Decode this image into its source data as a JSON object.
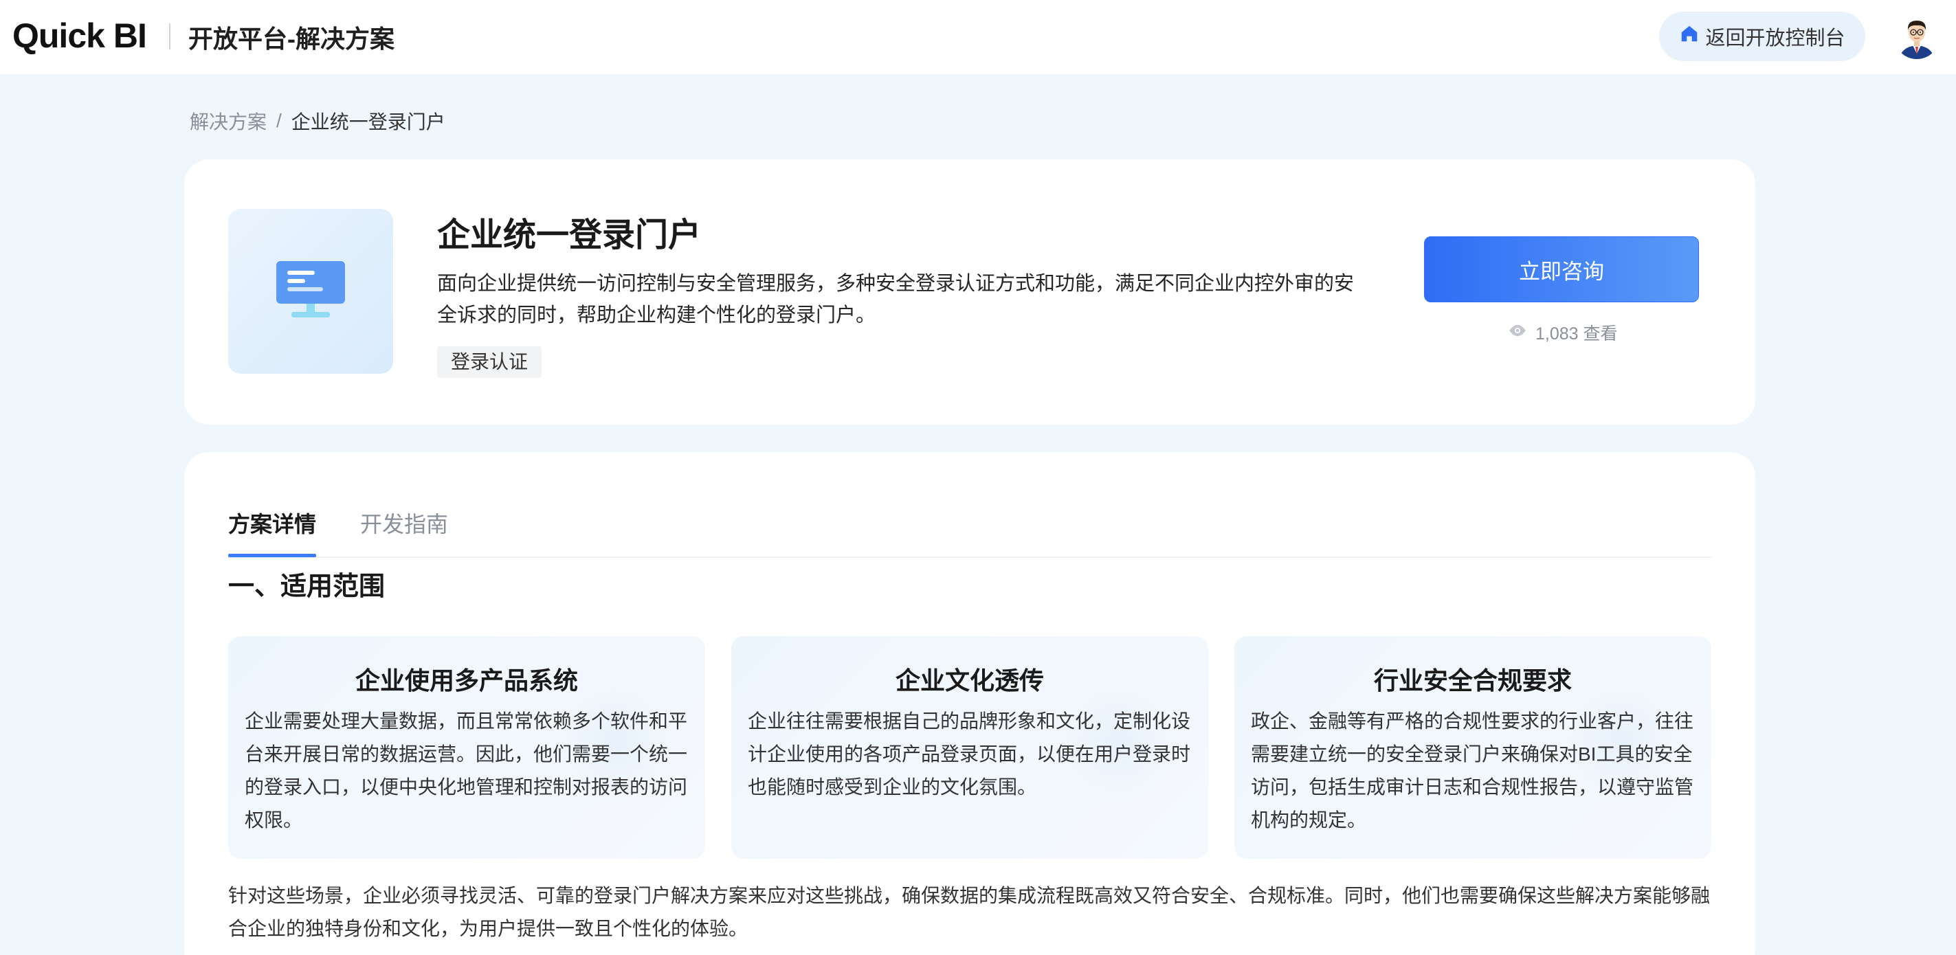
{
  "header": {
    "logo": "Quick BI",
    "platform_title": "开放平台-解决方案",
    "back_button_label": "返回开放控制台",
    "back_icon": "home-icon",
    "avatar": "user-avatar"
  },
  "breadcrumb": {
    "root": "解决方案",
    "separator": "/",
    "current": "企业统一登录门户"
  },
  "solution": {
    "icon": "monitor-icon",
    "title": "企业统一登录门户",
    "description": "面向企业提供统一访问控制与安全管理服务，多种安全登录认证方式和功能，满足不同企业内控外审的安全诉求的同时，帮助企业构建个性化的登录门户。",
    "tag": "登录认证",
    "consult_label": "立即咨询",
    "views_icon": "eye-icon",
    "views": "1,083 查看"
  },
  "tabs": [
    {
      "label": "方案详情",
      "active": true
    },
    {
      "label": "开发指南",
      "active": false
    }
  ],
  "content": {
    "section_title": "一、适用范围",
    "scenes": [
      {
        "title": "企业使用多产品系统",
        "description": "企业需要处理大量数据，而且常常依赖多个软件和平台来开展日常的数据运营。因此，他们需要一个统一的登录入口，以便中央化地管理和控制对报表的访问权限。"
      },
      {
        "title": "企业文化透传",
        "description": "企业往往需要根据自己的品牌形象和文化，定制化设计企业使用的各项产品登录页面，以便在用户登录时也能随时感受到企业的文化氛围。"
      },
      {
        "title": "行业安全合规要求",
        "description": "政企、金融等有严格的合规性要求的行业客户，往往需要建立统一的安全登录门户来确保对BI工具的安全访问，包括生成审计日志和合规性报告，以遵守监管机构的规定。"
      }
    ],
    "summary": "针对这些场景，企业必须寻找灵活、可靠的登录门户解决方案来应对这些挑战，确保数据的集成流程既高效又符合安全、合规标准。同时，他们也需要确保这些解决方案能够融合企业的独特身份和文化，为用户提供一致且个性化的体验。"
  },
  "colors": {
    "accent": "#2f6df5",
    "page_bg": "#f0f7fc",
    "card_bg": "#ffffff"
  }
}
